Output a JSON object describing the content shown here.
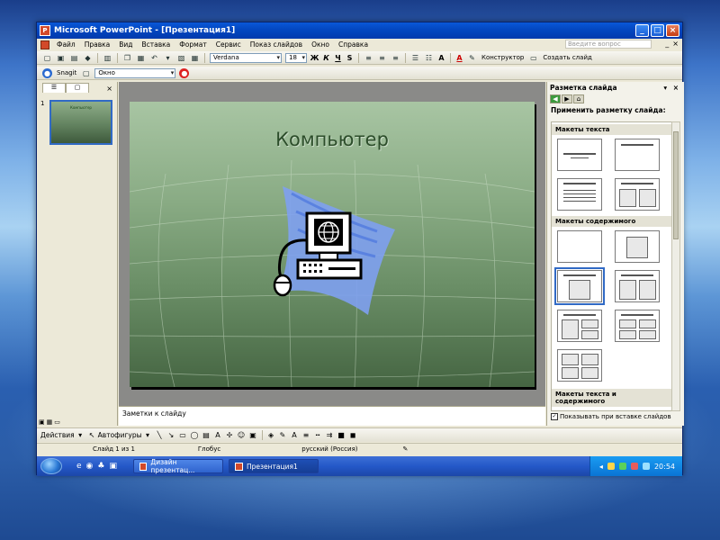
{
  "window": {
    "title": "Microsoft PowerPoint - [Презентация1]",
    "controls": [
      "_",
      "□",
      "×"
    ]
  },
  "menu": {
    "items": [
      "Файл",
      "Правка",
      "Вид",
      "Вставка",
      "Формат",
      "Сервис",
      "Показ слайдов",
      "Окно",
      "Справка"
    ],
    "help_placeholder": "Введите вопрос",
    "doc_controls": [
      "_",
      "×"
    ]
  },
  "toolbar1": {
    "font": "Verdana",
    "size": "18",
    "bold": "Ж",
    "italic": "К",
    "underline": "Ч",
    "shadow": "S",
    "grow_font": "A",
    "font_color": "A",
    "designer_label": "Конструктор",
    "new_slide_label": "Создать слайд"
  },
  "toolbar2": {
    "snagit_label": "Snagit",
    "window_combo": "Окно"
  },
  "slides_pane": {
    "slide_number": "1",
    "thumb_title": "Компьютер"
  },
  "slide": {
    "title": "Компьютер"
  },
  "notes": {
    "placeholder": "Заметки к слайду"
  },
  "task_pane": {
    "title": "Разметка слайда",
    "apply_label": "Применить разметку слайда:",
    "section_text": "Макеты текста",
    "section_content": "Макеты содержимого",
    "section_text_content": "Макеты текста и содержимого",
    "show_on_insert": "Показывать при вставке слайдов"
  },
  "drawing": {
    "actions_label": "Действия",
    "autoshapes_label": "Автофигуры"
  },
  "status": {
    "slide_of": "Слайд 1 из 1",
    "design": "Глобус",
    "language": "русский (Россия)"
  },
  "taskbar": {
    "task1": "Дизайн презентац...",
    "task2": "Презентация1",
    "clock": "20:54"
  },
  "colors": {
    "titlebar": "#0348c2",
    "slide_green": "#89ab84",
    "slide_title": "#2c4d2a",
    "selection": "#316ac5"
  }
}
